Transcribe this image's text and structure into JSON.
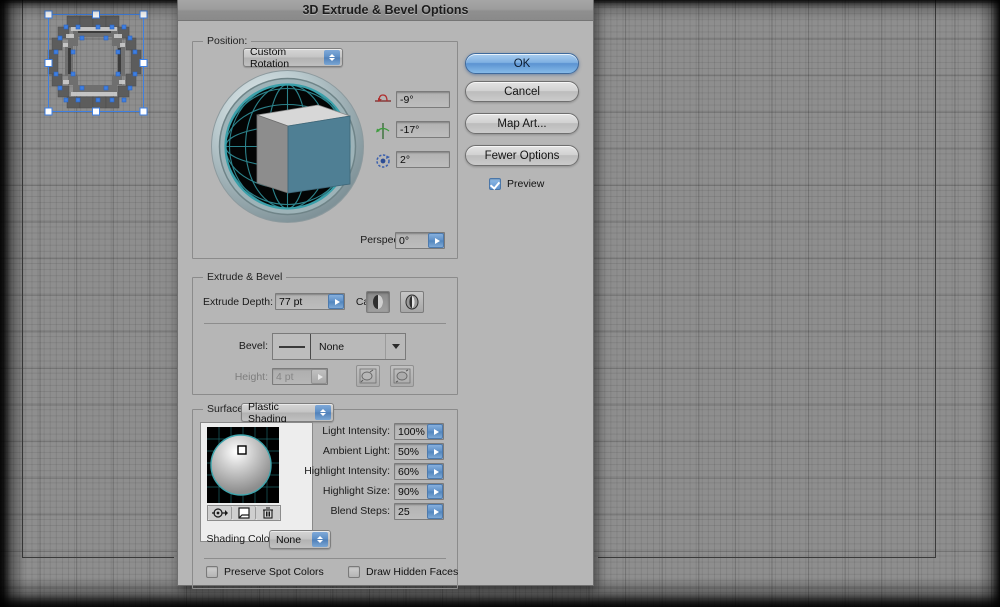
{
  "window": {
    "title": "3D Extrude & Bevel Options"
  },
  "position": {
    "label": "Position:",
    "value": "Custom Rotation",
    "rotation_x": {
      "icon": "rotate-x-axis-icon",
      "value": "-9°"
    },
    "rotation_y": {
      "icon": "rotate-y-axis-icon",
      "value": "-17°"
    },
    "rotation_z": {
      "icon": "rotate-z-axis-icon",
      "value": "2°"
    },
    "perspective_label": "Perspective:",
    "perspective_value": "0°"
  },
  "extrude": {
    "group_title": "Extrude & Bevel",
    "depth_label": "Extrude Depth:",
    "depth_value": "77 pt",
    "cap_label": "Cap:",
    "cap_solid_icon": "cap-solid-icon",
    "cap_hollow_icon": "cap-hollow-icon",
    "bevel_label": "Bevel:",
    "bevel_value": "None",
    "height_label": "Height:",
    "height_value": "4 pt",
    "bevel_out_icon": "bevel-extent-out-icon",
    "bevel_in_icon": "bevel-extent-in-icon"
  },
  "surface": {
    "group_title": "Surface:",
    "shading_value": "Plastic Shading",
    "light_preview_icon": "light-sphere-preview",
    "move_light_icon": "move-light-back-icon",
    "new_light_icon": "new-light-icon",
    "delete_light_icon": "delete-light-icon",
    "fields": [
      {
        "label": "Light Intensity:",
        "value": "100%"
      },
      {
        "label": "Ambient Light:",
        "value": "50%"
      },
      {
        "label": "Highlight Intensity:",
        "value": "60%"
      },
      {
        "label": "Highlight Size:",
        "value": "90%"
      },
      {
        "label": "Blend Steps:",
        "value": "25"
      }
    ],
    "shading_color_label": "Shading Color:",
    "shading_color_value": "None",
    "preserve_spot_label": "Preserve Spot Colors",
    "preserve_spot_checked": false,
    "draw_hidden_label": "Draw Hidden Faces",
    "draw_hidden_checked": false
  },
  "buttons": {
    "ok": "OK",
    "cancel": "Cancel",
    "map_art": "Map Art...",
    "fewer_options": "Fewer Options",
    "preview_label": "Preview",
    "preview_checked": true
  },
  "colors": {
    "dialog_bg": "#b6b6b6",
    "accent_blue": "#5b93d2",
    "cube_face": "#4f7f94",
    "grid_teal": "#2f8a93",
    "selection_blue": "#3f7fe0"
  }
}
